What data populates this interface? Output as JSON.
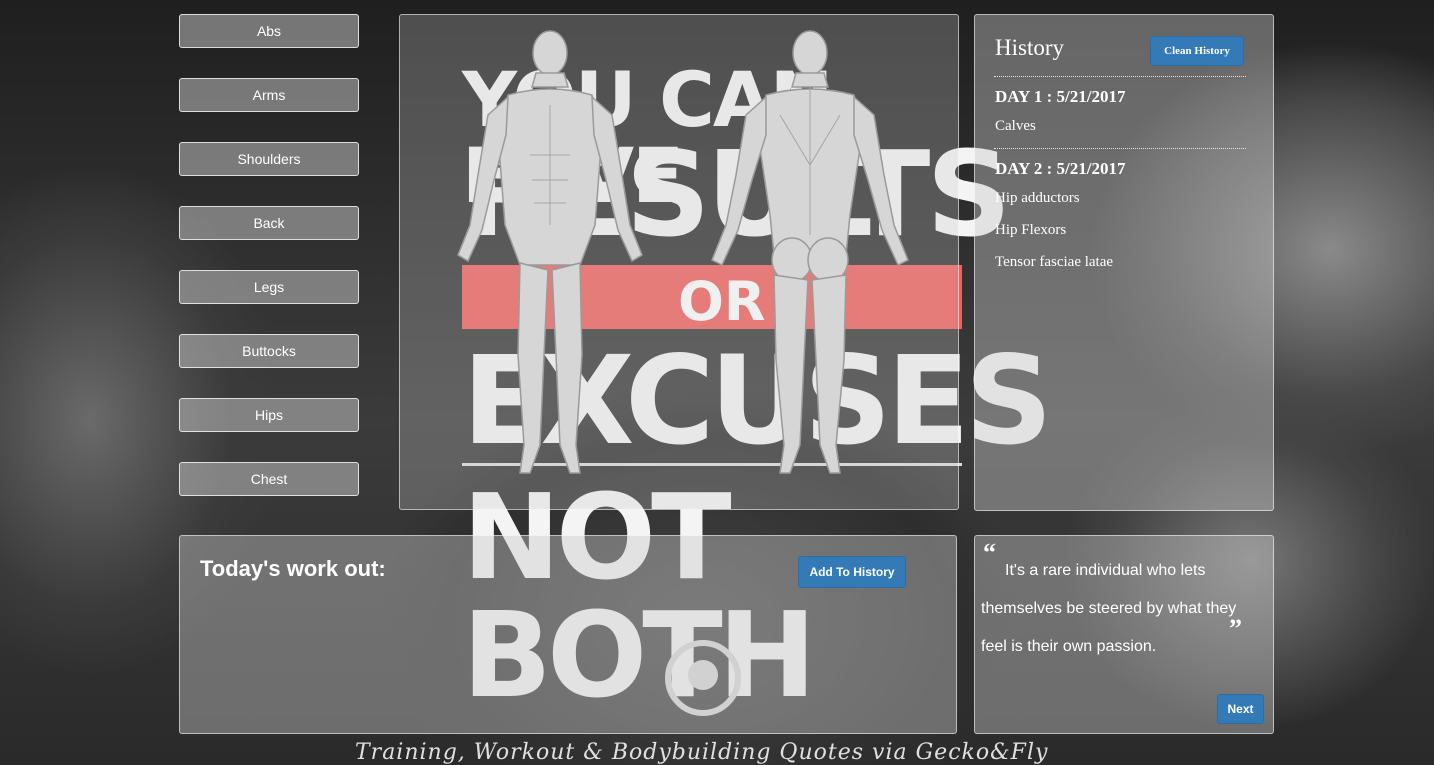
{
  "background": {
    "poster_lines": [
      "YOU CAN HAVE",
      "RESULTS",
      "OR",
      "EXCUSES",
      "NOT BOTH"
    ],
    "credit": "Training, Workout & Bodybuilding Quotes via Gecko&Fly",
    "accent_color": "#f25f5c"
  },
  "muscle_groups": [
    "Abs",
    "Arms",
    "Shoulders",
    "Back",
    "Legs",
    "Buttocks",
    "Hips",
    "Chest"
  ],
  "history": {
    "title": "History",
    "clean_label": "Clean History",
    "days": [
      {
        "title": "DAY 1 : 5/21/2017",
        "items": [
          "Calves"
        ]
      },
      {
        "title": "DAY 2 : 5/21/2017",
        "items": [
          "Hip adductors",
          "Hip Flexors",
          "Tensor fasciae latae"
        ]
      }
    ]
  },
  "workout": {
    "title": "Today's work out:",
    "add_label": "Add To History"
  },
  "quote": {
    "open_mark": "“",
    "close_mark": "”",
    "text": "It's a rare individual who lets themselves be steered by what they feel is their own passion.",
    "next_label": "Next"
  },
  "colors": {
    "button_blue": "#337ab7"
  }
}
